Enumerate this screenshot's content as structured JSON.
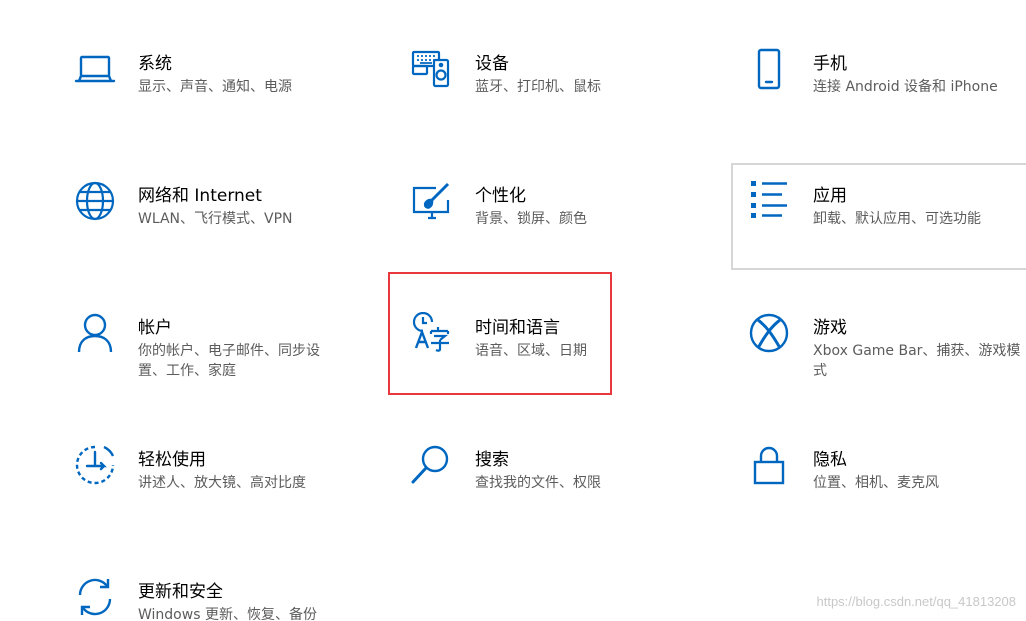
{
  "accent_color": "#0067c0",
  "highlight_color": "#e8383d",
  "watermark": "https://blog.csdn.net/qq_41813208",
  "tiles": [
    {
      "title": "系统",
      "desc": "显示、声音、通知、电源",
      "icon": "laptop-icon"
    },
    {
      "title": "设备",
      "desc": "蓝牙、打印机、鼠标",
      "icon": "keyboard-speaker-icon"
    },
    {
      "title": "手机",
      "desc": "连接 Android 设备和 iPhone",
      "icon": "phone-icon"
    },
    {
      "title": "网络和 Internet",
      "desc": "WLAN、飞行模式、VPN",
      "icon": "globe-icon"
    },
    {
      "title": "个性化",
      "desc": "背景、锁屏、颜色",
      "icon": "brush-monitor-icon"
    },
    {
      "title": "应用",
      "desc": "卸载、默认应用、可选功能",
      "icon": "app-list-icon"
    },
    {
      "title": "帐户",
      "desc": "你的帐户、电子邮件、同步设置、工作、家庭",
      "icon": "person-icon"
    },
    {
      "title": "时间和语言",
      "desc": "语音、区域、日期",
      "icon": "time-language-icon"
    },
    {
      "title": "游戏",
      "desc": "Xbox Game Bar、捕获、游戏模式",
      "icon": "xbox-icon"
    },
    {
      "title": "轻松使用",
      "desc": "讲述人、放大镜、高对比度",
      "icon": "ease-of-access-icon"
    },
    {
      "title": "搜索",
      "desc": "查找我的文件、权限",
      "icon": "search-icon"
    },
    {
      "title": "隐私",
      "desc": "位置、相机、麦克风",
      "icon": "lock-icon"
    },
    {
      "title": "更新和安全",
      "desc": "Windows 更新、恢复、备份",
      "icon": "sync-icon"
    }
  ]
}
